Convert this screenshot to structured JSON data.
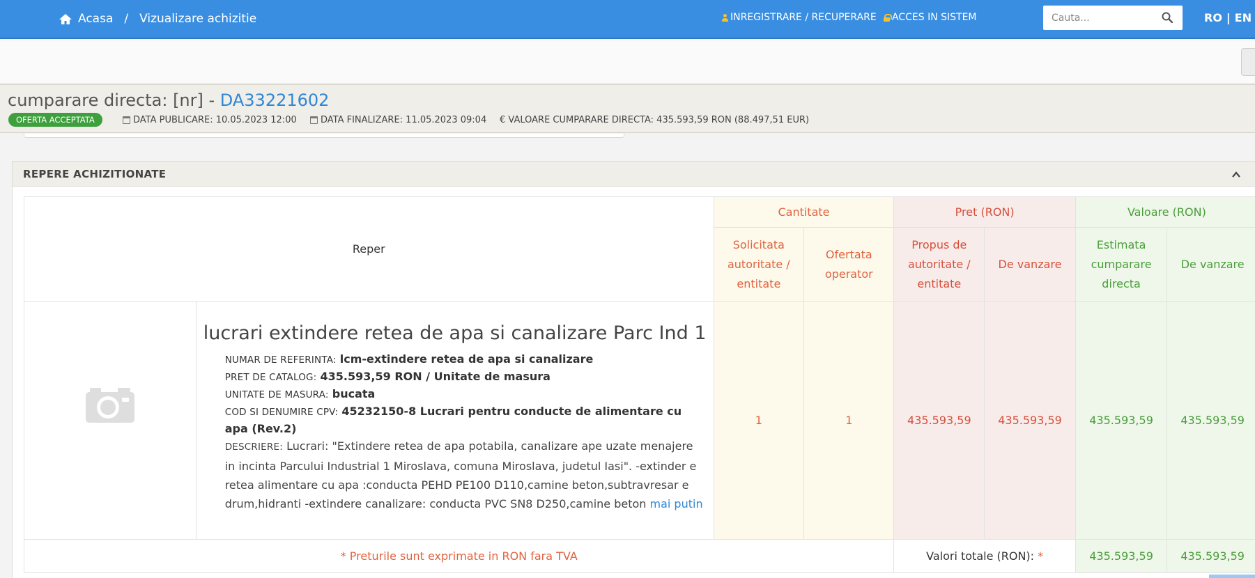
{
  "nav": {
    "breadcrumb_home": "Acasa",
    "breadcrumb_sep": "/",
    "breadcrumb_current": "Vizualizare achizitie",
    "register": "INREGISTRARE / RECUPERARE",
    "login": "ACCES IN SISTEM",
    "search_placeholder": "Cauta...",
    "lang_ro": "RO",
    "lang_sep": "|",
    "lang_en": "EN"
  },
  "header": {
    "title_prefix": "cumparare directa: [nr] - ",
    "title_id": "DA33221602",
    "status_badge": "OFERTA ACCEPTATA",
    "published": "DATA PUBLICARE: 10.05.2023 12:00",
    "finalized": "DATA FINALIZARE: 11.05.2023 09:04",
    "value": "€ VALOARE CUMPARARE DIRECTA: 435.593,59  RON (88.497,51  EUR)"
  },
  "panel": {
    "title": "REPERE ACHIZITIONATE"
  },
  "table": {
    "col_reper": "Reper",
    "group_cantitate": "Cantitate",
    "group_pret": "Pret (RON)",
    "group_valoare": "Valoare (RON)",
    "sub_solicitata": "Solicitata autoritate / entitate",
    "sub_ofertata": "Ofertata operator",
    "sub_propus": "Propus de autoritate / entitate",
    "sub_pret_vanzare": "De vanzare",
    "sub_estimata": "Estimata cumparare directa",
    "sub_val_vanzare": "De vanzare"
  },
  "item": {
    "title": "lucrari extindere retea de apa si canalizare Parc Ind 1",
    "ref_label": "NUMAR DE REFERINTA:",
    "ref_value": "lcm-extindere retea de apa si canalizare",
    "price_label": "PRET DE CATALOG:",
    "price_value": "435.593,59  RON / Unitate de masura",
    "unit_label": "UNITATE DE MASURA:",
    "unit_value": "bucata",
    "cpv_label": "COD SI DENUMIRE CPV:",
    "cpv_value": "45232150-8 Lucrari pentru conducte de alimentare cu apa (Rev.2)",
    "desc_label": "DESCRIERE:",
    "desc_value": "Lucrari: \"Extindere retea de apa potabila, canalizare ape uzate menajere in incinta Parcului Industrial 1 Miroslava, comuna Miroslava, judetul Iasi\". -extinder e retea alimentare cu apa :conducta PEHD PE100 D110,camine beton,subtravresar e drum,hidranti -extindere canalizare: conducta PVC SN8 D250,camine beton",
    "less_link": "mai putin",
    "qty_requested": "1",
    "qty_offered": "1",
    "price_proposed": "435.593,59",
    "price_sale": "435.593,59",
    "value_estimated": "435.593,59",
    "value_sale": "435.593,59"
  },
  "footer": {
    "note": "* Preturile sunt exprimate in RON fara TVA",
    "totals_label": "Valori totale (RON):",
    "totals_star": "*",
    "total_estimated": "435.593,59",
    "total_sale": "435.593,59"
  },
  "icons": {
    "home": "home-icon",
    "search": "search-icon",
    "calendar": "calendar-icon",
    "chevron": "chevron-up-icon",
    "image_placeholder": "camera-icon"
  },
  "colors": {
    "topbar": "#3a8ee2",
    "accent_link": "#2f87d6",
    "badge_green": "#3da03d",
    "quantity_text": "#e0623e",
    "price_text": "#d64f3b",
    "value_text": "#4a9e3a"
  }
}
